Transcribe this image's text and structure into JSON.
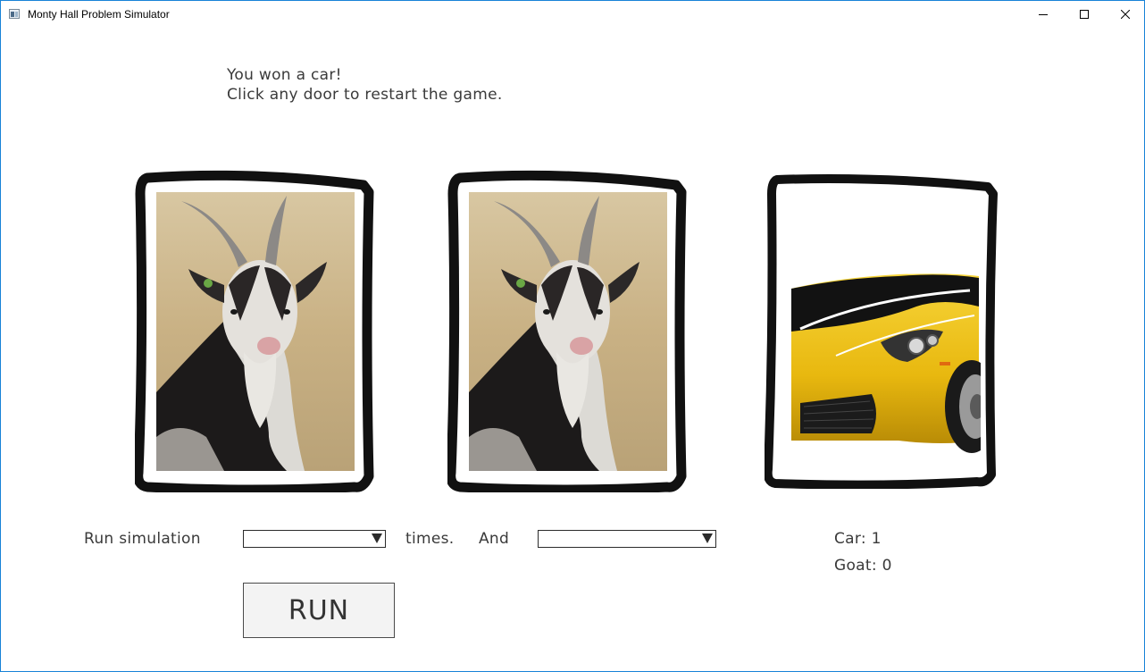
{
  "window": {
    "title": "Monty Hall Problem Simulator",
    "icon": "app-window-icon"
  },
  "message": {
    "line1": "You won a car!",
    "line2": "Click any door to restart the game."
  },
  "doors": [
    {
      "prize": "goat",
      "icon": "goat-image"
    },
    {
      "prize": "goat",
      "icon": "goat-image"
    },
    {
      "prize": "car",
      "icon": "yellow-sports-car-image"
    }
  ],
  "controls": {
    "run_label": "Run simulation",
    "times_label": "times.",
    "and_label": "And",
    "times_select": {
      "value": ""
    },
    "strategy_select": {
      "value": ""
    },
    "run_button": "RUN"
  },
  "stats": {
    "car": "Car: 1",
    "goat": "Goat: 0"
  },
  "colors": {
    "text": "#3a3a3a",
    "window_border": "#1883d7",
    "car_yellow": "#f2c418"
  }
}
